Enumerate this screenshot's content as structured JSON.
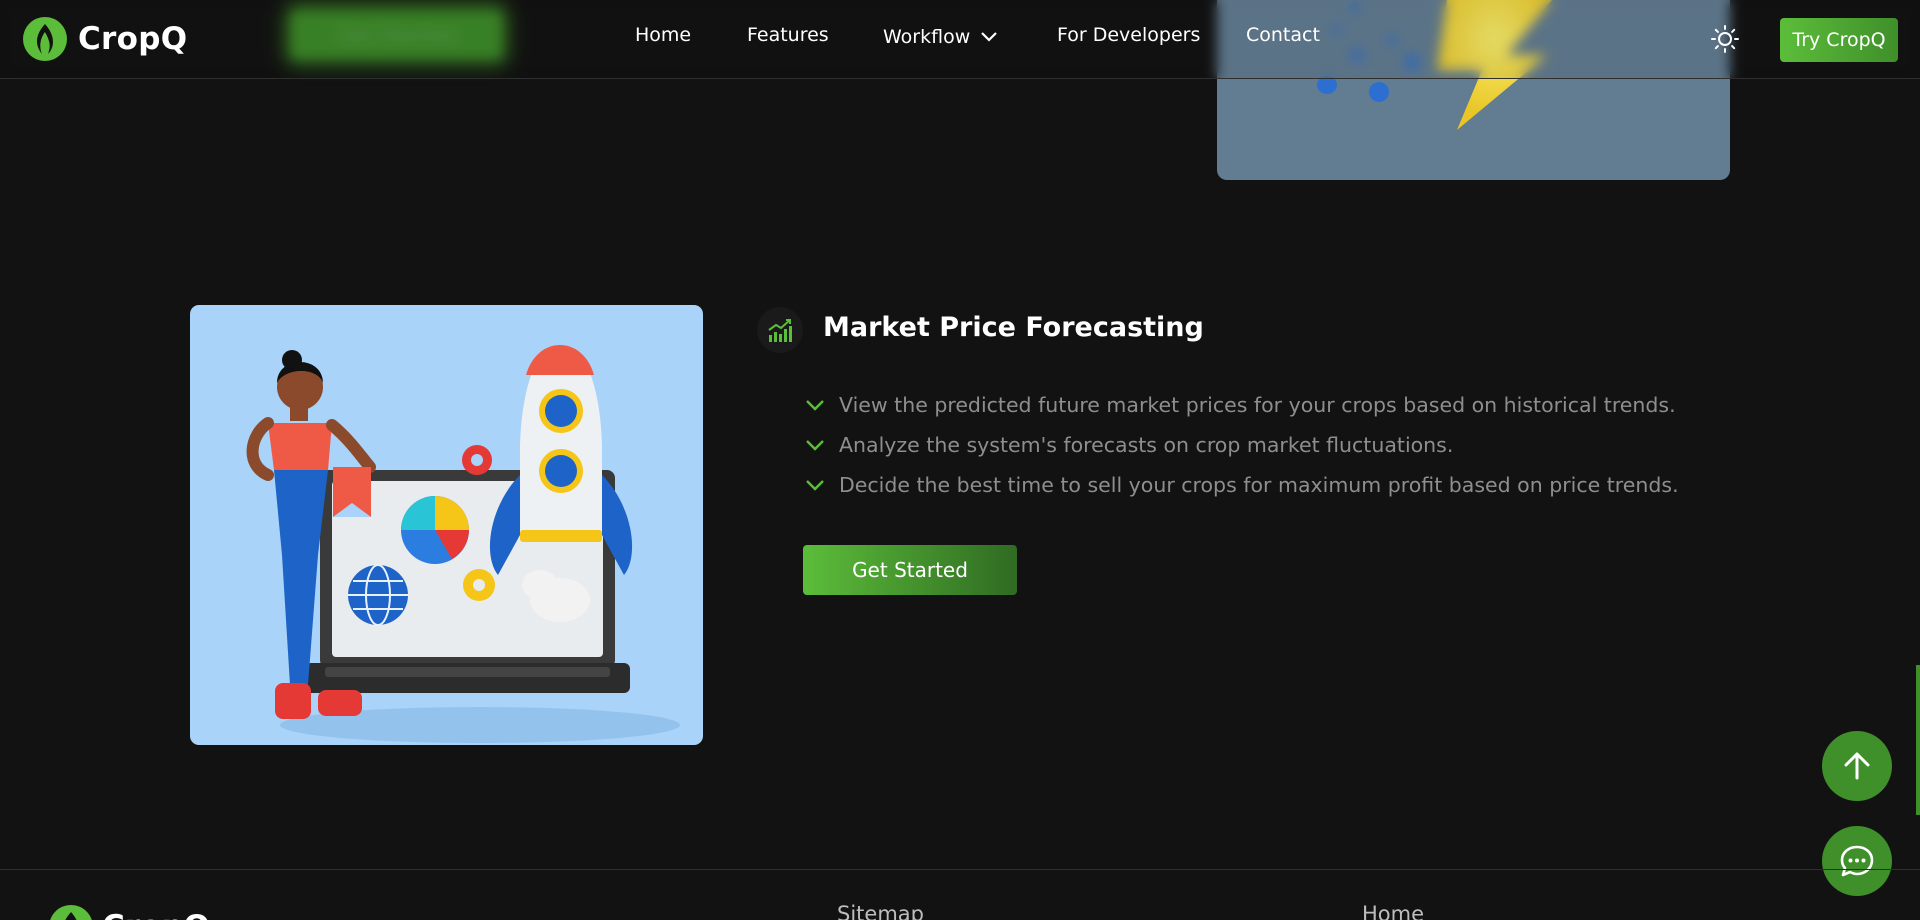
{
  "brand": {
    "name": "CropQ",
    "accent": "#5cbd3a",
    "accent_dark": "#3f8f2a"
  },
  "previous_section": {
    "get_started_label": "Get Started"
  },
  "nav": {
    "items": [
      {
        "label": "Home"
      },
      {
        "label": "Features"
      },
      {
        "label": "Workflow",
        "has_dropdown": true
      },
      {
        "label": "For Developers"
      },
      {
        "label": "Contact"
      }
    ],
    "theme_icon": "sun-icon",
    "try_label": "Try CropQ"
  },
  "feature": {
    "icon": "chart-growth-icon",
    "title": "Market Price Forecasting",
    "bullets": [
      "View the predicted future market prices for your crops based on historical trends.",
      "Analyze the system's forecasts on crop market fluctuations.",
      "Decide the best time to sell your crops for maximum profit based on price trends."
    ],
    "cta_label": "Get Started"
  },
  "floating": {
    "scroll_top_icon": "arrow-up-icon",
    "chat_icon": "chat-bubble-icon"
  },
  "footer": {
    "brand": "CropQ",
    "columns": [
      {
        "title": "Sitemap"
      },
      {
        "title": "Home"
      }
    ]
  }
}
